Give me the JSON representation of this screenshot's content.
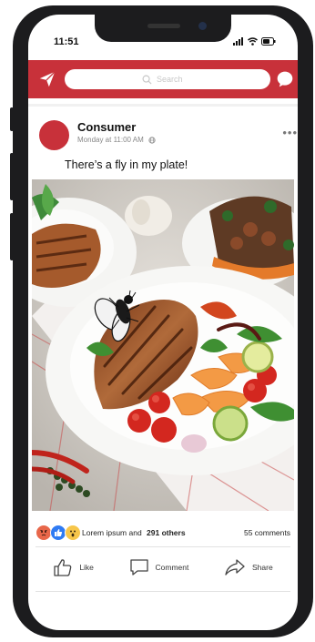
{
  "status_bar": {
    "time": "11:51"
  },
  "header": {
    "search_placeholder": "Search"
  },
  "post": {
    "author": "Consumer",
    "timestamp": "Monday at 11:00 AM",
    "text": "There’s a fly in my plate!",
    "reactions_label": "Lorem ipsum and",
    "reactions_count": "291 others",
    "comments_count": "55 comments"
  },
  "actions": {
    "like": "Like",
    "comment": "Comment",
    "share": "Share"
  },
  "colors": {
    "brand": "#c8313a",
    "background": "#ffffff",
    "frame": "#1c1c1e"
  },
  "icons": [
    "send-icon",
    "search-icon",
    "chat-bubble-icon",
    "globe-icon",
    "more-dots-icon",
    "angry-reaction-icon",
    "like-reaction-icon",
    "wow-reaction-icon",
    "thumbs-up-icon",
    "comment-icon",
    "share-icon"
  ]
}
